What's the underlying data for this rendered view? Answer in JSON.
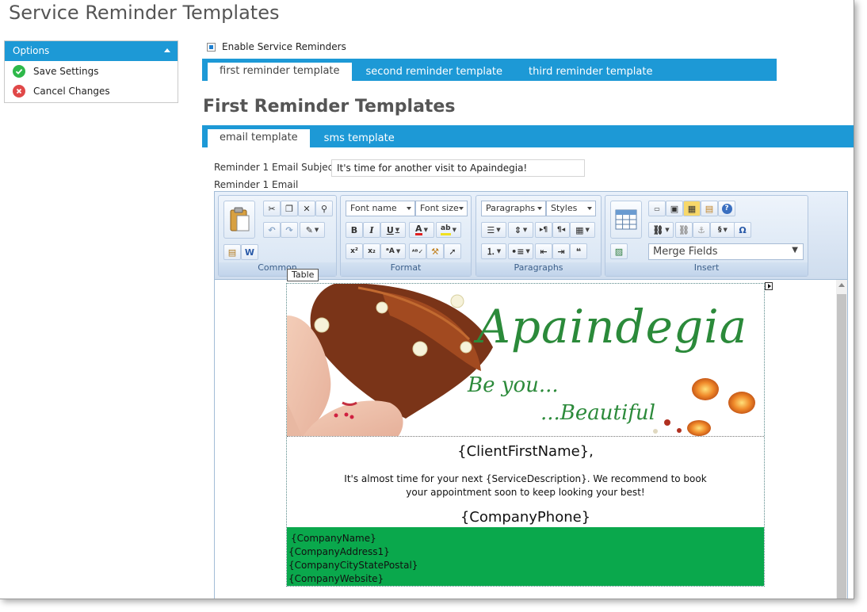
{
  "page": {
    "title": "Service Reminder Templates"
  },
  "options": {
    "header": "Options",
    "items": [
      {
        "label": "Save Settings"
      },
      {
        "label": "Cancel Changes"
      }
    ]
  },
  "enable": {
    "label": "Enable Service Reminders",
    "checked": true
  },
  "reminder_tabs": [
    {
      "label": "first reminder template"
    },
    {
      "label": "second reminder template"
    },
    {
      "label": "third reminder template"
    }
  ],
  "section": {
    "title": "First Reminder Templates"
  },
  "template_tabs": [
    {
      "label": "email template"
    },
    {
      "label": "sms template"
    }
  ],
  "subject": {
    "label": "Reminder 1 Email Subject",
    "value": "It's time for another visit to Apaindegia!"
  },
  "email_label": "Reminder 1 Email",
  "ribbon": {
    "groups": {
      "common": "Common",
      "format": "Format",
      "paragraphs": "Paragraphs",
      "insert": "Insert"
    },
    "font_name": "Font name",
    "font_size": "Font size",
    "paragraphs": "Paragraphs",
    "styles": "Styles",
    "merge_fields": "Merge Fields",
    "bold": "B",
    "italic": "I",
    "underline": "U"
  },
  "tooltip": "Table",
  "email": {
    "brand": "Apaindegia",
    "tagline1": "Be you...",
    "tagline2": "...Beautiful",
    "greeting": "{ClientFirstName},",
    "body": "It's almost time for your next {ServiceDescription}. We recommend to book your appointment soon to keep looking your best!",
    "phone": "{CompanyPhone}",
    "footer": [
      "{CompanyName}",
      "{CompanyAddress1}",
      "{CompanyCityStatePostal}",
      "{CompanyWebsite}"
    ]
  },
  "colors": {
    "accent": "#1d99d6",
    "footer": "#0aa84c",
    "brand": "#2b8a3a"
  }
}
